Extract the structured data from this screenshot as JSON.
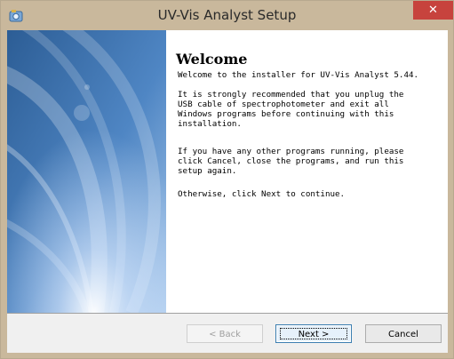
{
  "window": {
    "title": "UV-Vis Analyst Setup",
    "icon": "installer-icon",
    "close_label": "✕"
  },
  "content": {
    "heading": "Welcome",
    "paragraphs": [
      "Welcome to the installer for UV-Vis Analyst 5.44.",
      "It is strongly recommended that you unplug the\nUSB cable of spectrophotometer and exit all\nWindows programs before continuing with this\ninstallation.",
      "If you have any other programs running, please\nclick Cancel, close the programs, and run this\nsetup again.",
      "Otherwise, click Next to continue."
    ]
  },
  "buttons": {
    "back_label": "< Back",
    "next_label": "Next >",
    "cancel_label": "Cancel"
  },
  "colors": {
    "titlebar": "#c9b89c",
    "close": "#c7433d",
    "side_panel": "#3d6fa6"
  }
}
